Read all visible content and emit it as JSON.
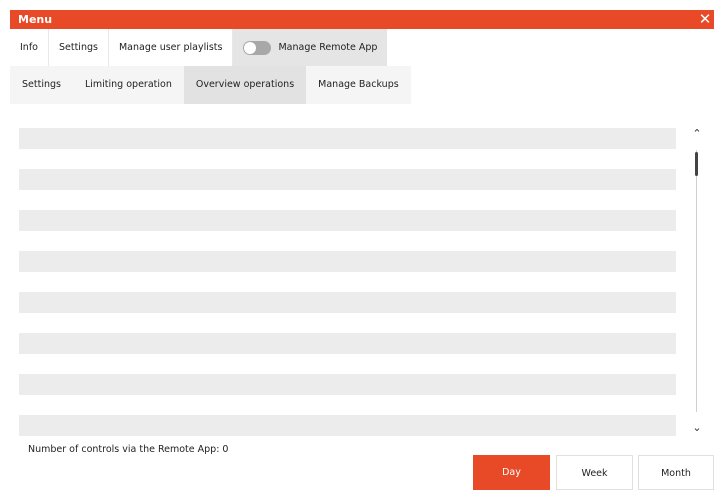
{
  "window": {
    "title": "Menu",
    "close_icon": "close-icon",
    "close_glyph": "✕",
    "accent": "#e84a27"
  },
  "main_tabs": [
    {
      "label": "Info"
    },
    {
      "label": "Settings"
    },
    {
      "label": "Manage user playlists"
    },
    {
      "label": "Manage Remote App",
      "toggle_on": false
    }
  ],
  "sub_tabs": [
    {
      "label": "Settings"
    },
    {
      "label": "Limiting operation"
    },
    {
      "label": "Overview operations",
      "active": true
    },
    {
      "label": "Manage Backups"
    }
  ],
  "list": {
    "row_count": 8
  },
  "scrollbar": {
    "up_glyph": "⌃",
    "down_glyph": "⌄"
  },
  "footer": {
    "remote_count_label": "Number of controls via the Remote App: 0"
  },
  "period_buttons": {
    "day": "Day",
    "week": "Week",
    "month": "Month",
    "selected": "Day"
  }
}
